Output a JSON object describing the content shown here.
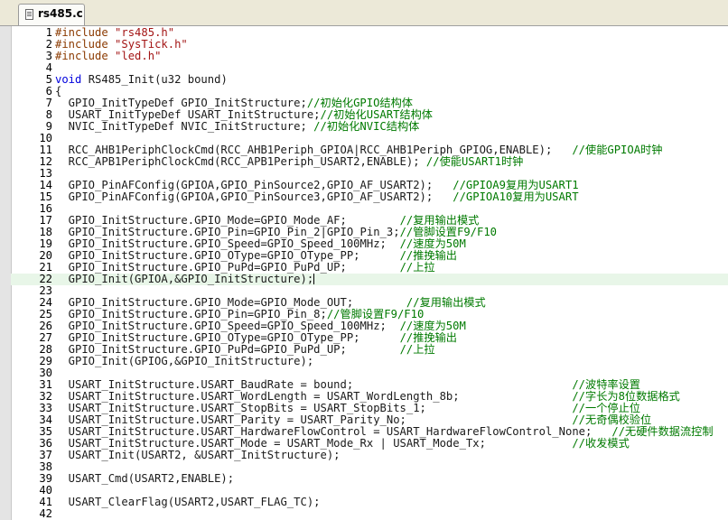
{
  "tab": {
    "label": "rs485.c",
    "icon": "c-file-icon"
  },
  "code_lines": [
    {
      "n": "1",
      "code": "#include \"rs485.h\"",
      "type": "include"
    },
    {
      "n": "2",
      "code": "#include \"SysTick.h\"",
      "type": "include"
    },
    {
      "n": "3",
      "code": "#include \"led.h\"",
      "type": "include"
    },
    {
      "n": "4",
      "code": ""
    },
    {
      "n": "5",
      "code": "void RS485_Init(u32 bound)",
      "type": "func"
    },
    {
      "n": "6",
      "code": "{"
    },
    {
      "n": "7",
      "code": "  GPIO_InitTypeDef GPIO_InitStructure;",
      "comment": "//初始化GPIO结构体"
    },
    {
      "n": "8",
      "code": "  USART_InitTypeDef USART_InitStructure;",
      "comment": "//初始化USART结构体"
    },
    {
      "n": "9",
      "code": "  NVIC_InitTypeDef NVIC_InitStructure; ",
      "comment": "//初始化NVIC结构体"
    },
    {
      "n": "10",
      "code": ""
    },
    {
      "n": "11",
      "code": "  RCC_AHB1PeriphClockCmd(RCC_AHB1Periph_GPIOA|RCC_AHB1Periph_GPIOG,ENABLE);   ",
      "comment": "//使能GPIOA时钟"
    },
    {
      "n": "12",
      "code": "  RCC_APB1PeriphClockCmd(RCC_APB1Periph_USART2,ENABLE); ",
      "comment": "//使能USART1时钟"
    },
    {
      "n": "13",
      "code": ""
    },
    {
      "n": "14",
      "code": "  GPIO_PinAFConfig(GPIOA,GPIO_PinSource2,GPIO_AF_USART2);   ",
      "comment": "//GPIOA9复用为USART1"
    },
    {
      "n": "15",
      "code": "  GPIO_PinAFConfig(GPIOA,GPIO_PinSource3,GPIO_AF_USART2);   ",
      "comment": "//GPIOA10复用为USART"
    },
    {
      "n": "16",
      "code": ""
    },
    {
      "n": "17",
      "code": "  GPIO_InitStructure.GPIO_Mode=GPIO_Mode_AF;        ",
      "comment": "//复用输出模式"
    },
    {
      "n": "18",
      "code": "  GPIO_InitStructure.GPIO_Pin=GPIO_Pin_2|GPIO_Pin_3;",
      "comment": "//管脚设置F9/F10"
    },
    {
      "n": "19",
      "code": "  GPIO_InitStructure.GPIO_Speed=GPIO_Speed_100MHz;  ",
      "comment": "//速度为50M"
    },
    {
      "n": "20",
      "code": "  GPIO_InitStructure.GPIO_OType=GPIO_OType_PP;      ",
      "comment": "//推挽输出"
    },
    {
      "n": "21",
      "code": "  GPIO_InitStructure.GPIO_PuPd=GPIO_PuPd_UP;        ",
      "comment": "//上拉"
    },
    {
      "n": "22",
      "code": "  GPIO_Init(GPIOA,&GPIO_InitStructure);",
      "highlight": true,
      "caret": true
    },
    {
      "n": "23",
      "code": ""
    },
    {
      "n": "24",
      "code": "  GPIO_InitStructure.GPIO_Mode=GPIO_Mode_OUT;        ",
      "comment": "//复用输出模式"
    },
    {
      "n": "25",
      "code": "  GPIO_InitStructure.GPIO_Pin=GPIO_Pin_8;",
      "comment": "//管脚设置F9/F10"
    },
    {
      "n": "26",
      "code": "  GPIO_InitStructure.GPIO_Speed=GPIO_Speed_100MHz;  ",
      "comment": "//速度为50M"
    },
    {
      "n": "27",
      "code": "  GPIO_InitStructure.GPIO_OType=GPIO_OType_PP;      ",
      "comment": "//推挽输出"
    },
    {
      "n": "28",
      "code": "  GPIO_InitStructure.GPIO_PuPd=GPIO_PuPd_UP;        ",
      "comment": "//上拉"
    },
    {
      "n": "29",
      "code": "  GPIO_Init(GPIOG,&GPIO_InitStructure);"
    },
    {
      "n": "30",
      "code": ""
    },
    {
      "n": "31",
      "code": "  USART_InitStructure.USART_BaudRate = bound;                                 ",
      "comment": "//波特率设置"
    },
    {
      "n": "32",
      "code": "  USART_InitStructure.USART_WordLength = USART_WordLength_8b;                 ",
      "comment": "//字长为8位数据格式"
    },
    {
      "n": "33",
      "code": "  USART_InitStructure.USART_StopBits = USART_StopBits_1;                      ",
      "comment": "//一个停止位"
    },
    {
      "n": "34",
      "code": "  USART_InitStructure.USART_Parity = USART_Parity_No;                         ",
      "comment": "//无奇偶校验位"
    },
    {
      "n": "35",
      "code": "  USART_InitStructure.USART_HardwareFlowControl = USART_HardwareFlowControl_None;   ",
      "comment": "//无硬件数据流控制"
    },
    {
      "n": "36",
      "code": "  USART_InitStructure.USART_Mode = USART_Mode_Rx | USART_Mode_Tx;             ",
      "comment": "//收发模式"
    },
    {
      "n": "37",
      "code": "  USART_Init(USART2, &USART_InitStructure);"
    },
    {
      "n": "38",
      "code": ""
    },
    {
      "n": "39",
      "code": "  USART_Cmd(USART2,ENABLE);"
    },
    {
      "n": "40",
      "code": ""
    },
    {
      "n": "41",
      "code": "  USART_ClearFlag(USART2,USART_FLAG_TC);"
    },
    {
      "n": "42",
      "code": ""
    }
  ],
  "colors": {
    "keyword": "#0000dd",
    "preprocessor": "#8b3a00",
    "string": "#a31515",
    "comment": "#007a00",
    "current_line": "#e8f6e8",
    "tabbar": "#ece9d8"
  }
}
